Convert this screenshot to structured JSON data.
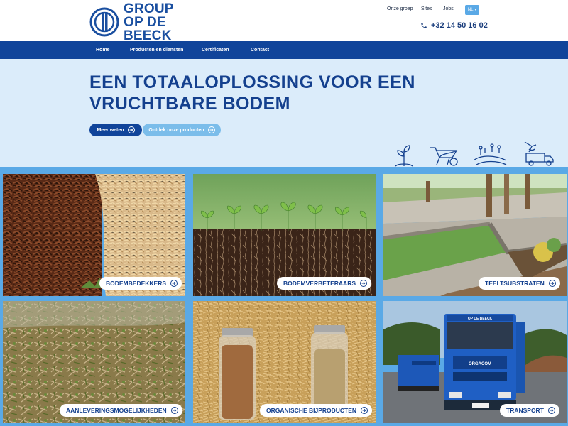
{
  "brand": {
    "line1": "GROUP",
    "line2": "OP DE BEECK",
    "color": "#1a4fa0"
  },
  "utility_nav": {
    "items": [
      "Onze groep",
      "Sites",
      "Jobs"
    ],
    "language": "NL"
  },
  "phone": "+32 14 50 16 02",
  "main_nav": {
    "items": [
      "Home",
      "Producten en diensten",
      "Certificaten",
      "Contact"
    ]
  },
  "hero": {
    "title_line1": "EEN TOTAALOPLOSSING VOOR EEN",
    "title_line2": "VRUCHTBARE BODEM",
    "primary_button": "Meer weten",
    "secondary_button": "Ontdek onze producten",
    "icons": [
      "sprout-icon",
      "wheelbarrow-icon",
      "field-icon",
      "truck-loading-icon"
    ]
  },
  "tiles": [
    {
      "label": "BODEMBEDEKKERS"
    },
    {
      "label": "BODEMVERBETERAARS"
    },
    {
      "label": "TEELTSUBSTRATEN"
    },
    {
      "label": "AANLEVERINGSMOGELIJKHEDEN"
    },
    {
      "label": "ORGANISCHE BIJPRODUCTEN"
    },
    {
      "label": "TRANSPORT"
    }
  ],
  "truck_text": {
    "cab": "OP DE BEECK",
    "trailer": "ORGACOM"
  },
  "colors": {
    "navy": "#10449a",
    "light_blue": "#5aa9e6",
    "hero_bg": "#dbecfa"
  }
}
